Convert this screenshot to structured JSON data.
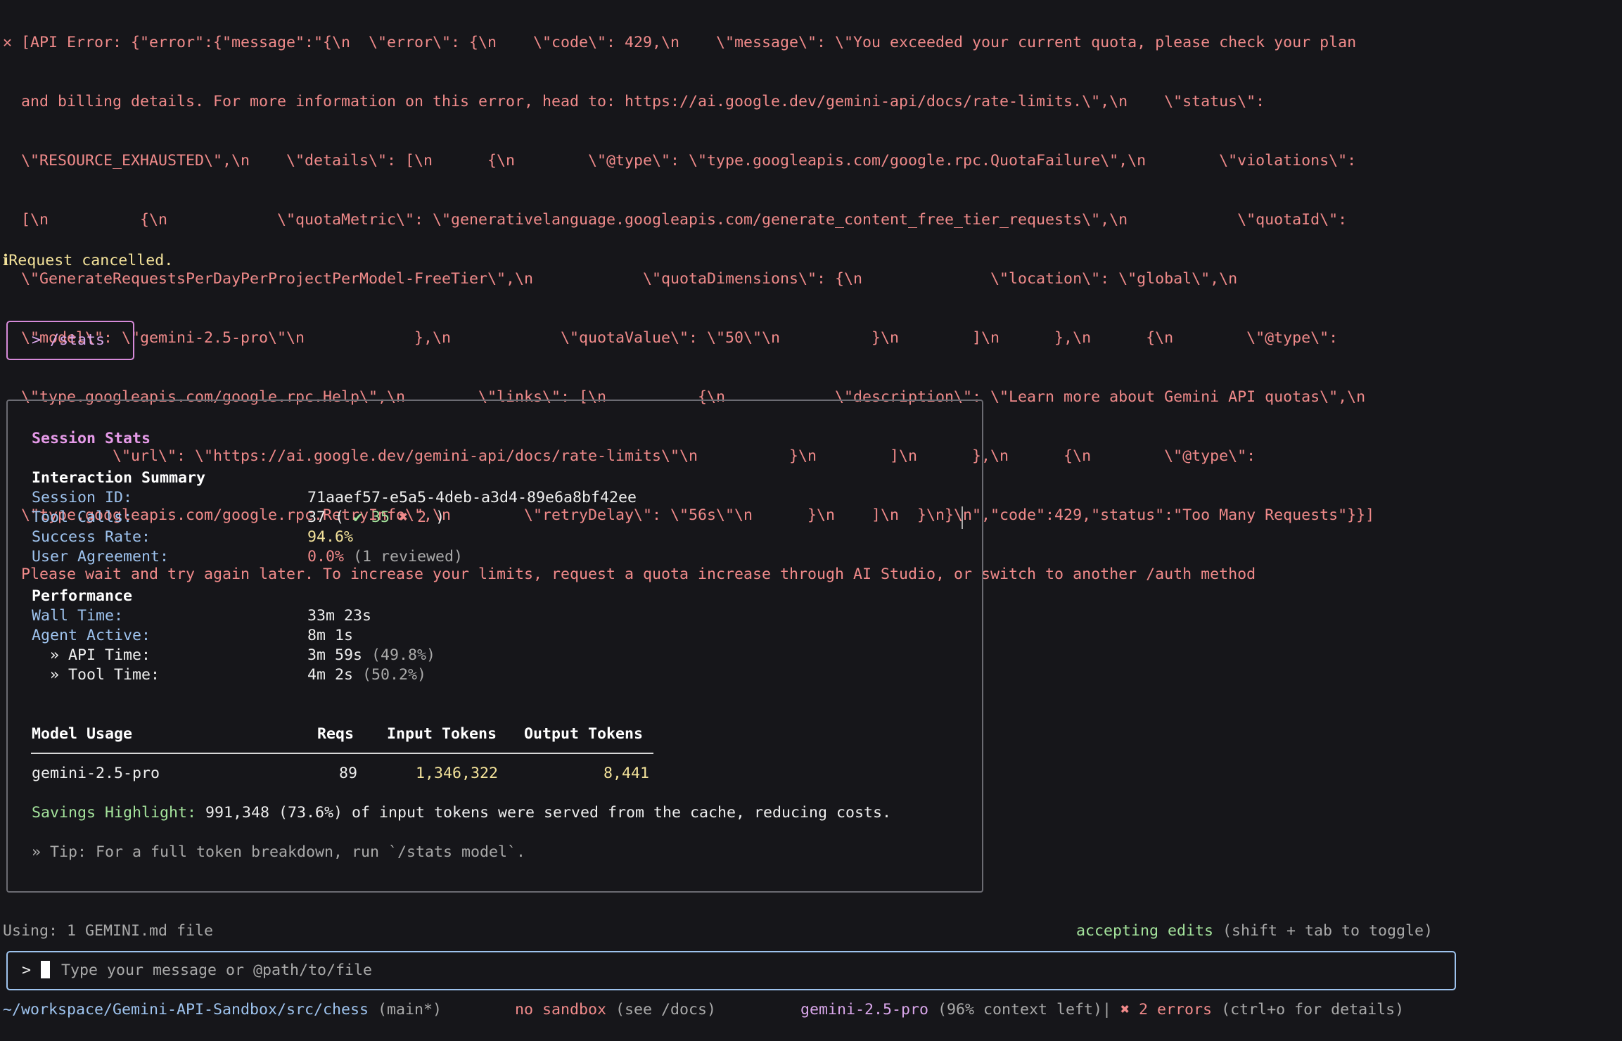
{
  "error": {
    "lines": [
      "✕ [API Error: {\"error\":{\"message\":\"{\\n  \\\"error\\\": {\\n    \\\"code\\\": 429,\\n    \\\"message\\\": \\\"You exceeded your current quota, please check your plan",
      "  and billing details. For more information on this error, head to: https://ai.google.dev/gemini-api/docs/rate-limits.\\\",\\n    \\\"status\\\":",
      "  \\\"RESOURCE_EXHAUSTED\\\",\\n    \\\"details\\\": [\\n      {\\n        \\\"@type\\\": \\\"type.googleapis.com/google.rpc.QuotaFailure\\\",\\n        \\\"violations\\\":",
      "  [\\n          {\\n            \\\"quotaMetric\\\": \\\"generativelanguage.googleapis.com/generate_content_free_tier_requests\\\",\\n            \\\"quotaId\\\":",
      "  \\\"GenerateRequestsPerDayPerProjectPerModel-FreeTier\\\",\\n            \\\"quotaDimensions\\\": {\\n              \\\"location\\\": \\\"global\\\",\\n",
      "  \\\"model\\\": \\\"gemini-2.5-pro\\\"\\n            },\\n            \\\"quotaValue\\\": \\\"50\\\"\\n          }\\n        ]\\n      },\\n      {\\n        \\\"@type\\\":",
      "  \\\"type.googleapis.com/google.rpc.Help\\\",\\n        \\\"links\\\": [\\n          {\\n            \\\"description\\\": \\\"Learn more about Gemini API quotas\\\",\\n",
      "            \\\"url\\\": \\\"https://ai.google.dev/gemini-api/docs/rate-limits\\\"\\n          }\\n        ]\\n      },\\n      {\\n        \\\"@type\\\":",
      "  \\\"type.googleapis.com/google.rpc.RetryInfo\\\",\\n        \\\"retryDelay\\\": \\\"56s\\\"\\n      }\\n    ]\\n  }\\n}\\n\",\"code\":429,\"status\":\"Too Many Requests\"}}]",
      "  Please wait and try again later. To increase your limits, request a quota increase through AI Studio, or switch to another /auth method"
    ]
  },
  "cancel_message": "ℹRequest cancelled.",
  "command": "> /stats",
  "stats": {
    "title": "Session Stats",
    "interaction": {
      "heading": "Interaction Summary",
      "session_id_label": "Session ID:",
      "session_id": "71aaef57-e5a5-4deb-a3d4-89e6a8bf42ee",
      "tool_calls_label": "Tool Calls:",
      "tool_calls_total": "37 ( ",
      "tool_calls_success": "✔ 35",
      "tool_calls_failed": "✖ 2",
      "tool_calls_close": " )",
      "success_rate_label": "Success Rate:",
      "success_rate": "94.6%",
      "agreement_label": "User Agreement:",
      "agreement": "0.0%",
      "agreement_note": " (1 reviewed)"
    },
    "performance": {
      "heading": "Performance",
      "wall_label": "Wall Time:",
      "wall": "33m 23s",
      "agent_label": "Agent Active:",
      "agent": "8m 1s",
      "api_label": "  » API Time:",
      "api": "3m 59s",
      "api_pct": " (49.8%)",
      "tool_label": "  » Tool Time:",
      "tool": "4m 2s",
      "tool_pct": " (50.2%)"
    },
    "model_usage": {
      "headers": {
        "model": "Model Usage",
        "reqs": "Reqs",
        "input": "Input Tokens",
        "output": "Output Tokens"
      },
      "rows": [
        {
          "model": "gemini-2.5-pro",
          "reqs": "89",
          "input": "1,346,322",
          "output": "8,441"
        }
      ]
    },
    "savings_label": "Savings Highlight:",
    "savings_text": " 991,348 (73.6%) of input tokens were served from the cache, reducing costs.",
    "tip": "» Tip: For a full token breakdown, run `/stats model`."
  },
  "status_top": {
    "context_files": "Using: 1 GEMINI.md file",
    "mode": "accepting edits",
    "mode_hint": " (shift + tab to toggle)"
  },
  "input": {
    "prompt": ">",
    "placeholder": "Type your message or @path/to/file"
  },
  "footer": {
    "path": "~/workspace/Gemini-API-Sandbox/src/chess",
    "branch": " (main*)",
    "sandbox": "no sandbox",
    "sandbox_hint": " (see /docs)",
    "model": "gemini-2.5-pro",
    "context": " (96% context left)",
    "separator": "|",
    "errors": " ✖ 2 errors",
    "errors_hint": " (ctrl+o for details)"
  },
  "colors": {
    "background": "#16161a",
    "error": "#f08a8a",
    "warning": "#f3e29a",
    "accent_pink": "#e59ae8",
    "accent_blue": "#9ec3ee",
    "success": "#a4e39c"
  }
}
